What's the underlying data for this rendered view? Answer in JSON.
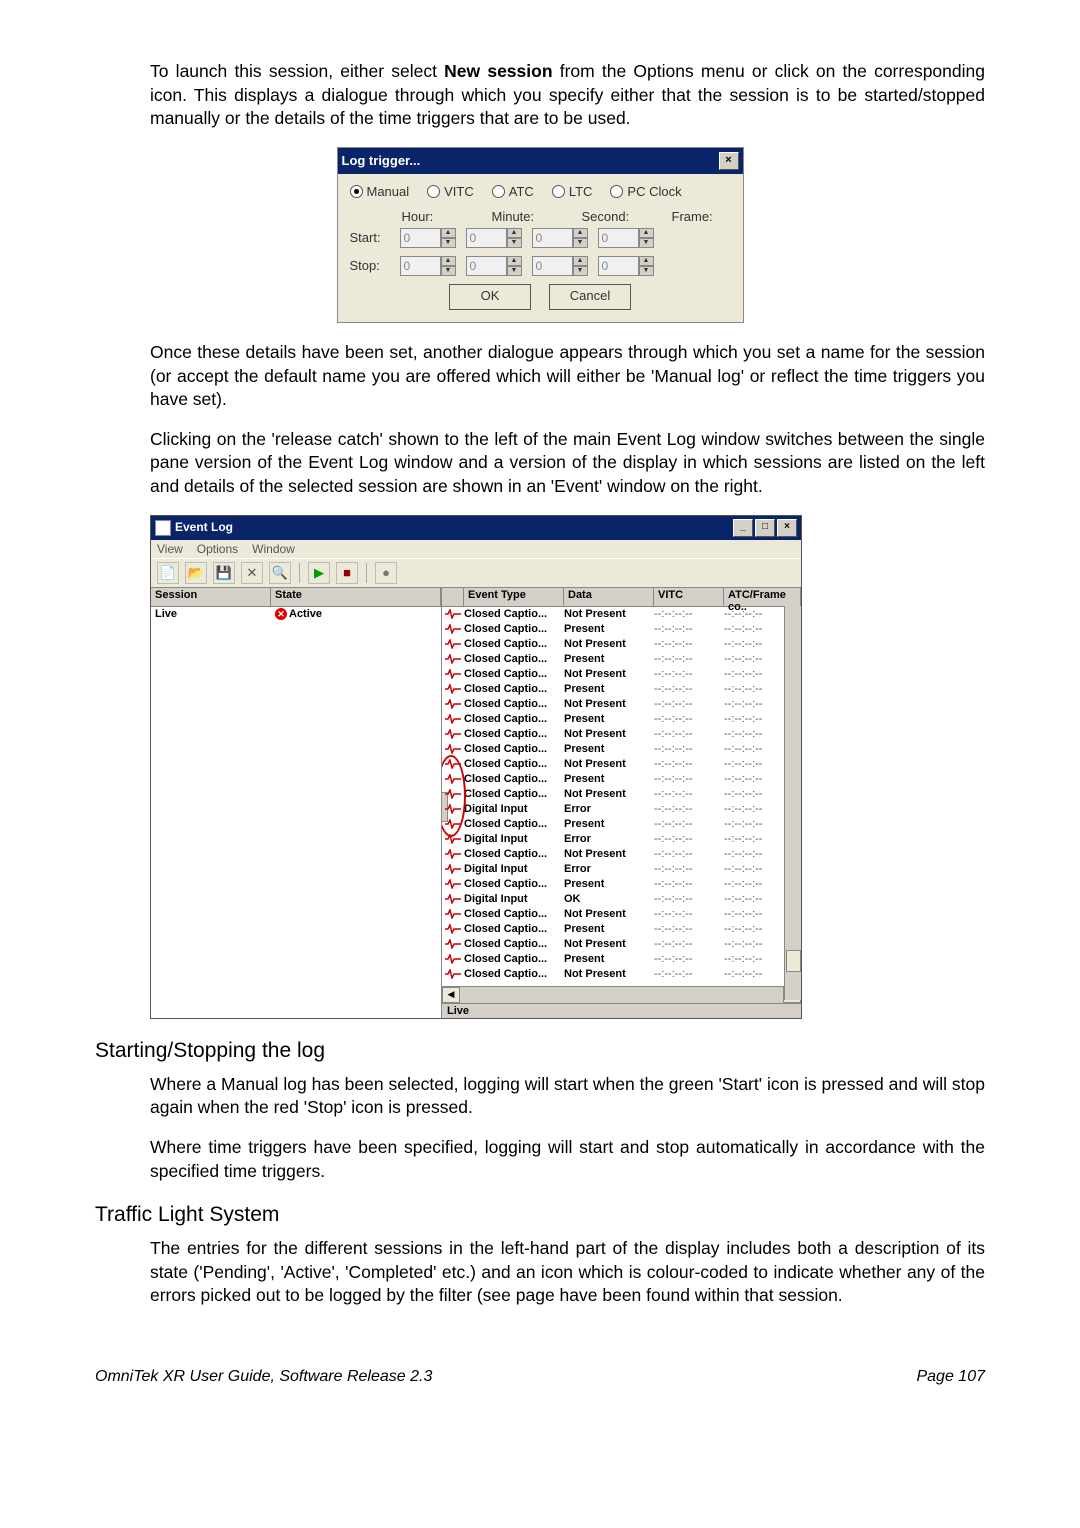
{
  "paragraphs": {
    "p1a": "To launch this session, either select ",
    "p1bold": "New session",
    "p1b": " from the Options menu or click on the corresponding icon. This displays a dialogue through which you specify either that the session is to be started/stopped manually or the details of the time triggers that are to be used.",
    "p2": "Once these details have been set, another dialogue appears through which you set a name for the session (or accept the default name you are offered which will either be 'Manual log' or reflect the time triggers you have set).",
    "p3": "Clicking on the 'release catch' shown to the left of the main Event Log window switches between the single pane version of the Event Log window and a version of the display in which sessions are listed on the left and details of the selected session are shown in an 'Event' window on the right.",
    "p4": "Where a Manual log has been selected, logging will start when the green 'Start' icon is pressed and will stop again when the red 'Stop' icon is pressed.",
    "p5": "Where time triggers have been specified, logging will start and stop automatically in accordance with the specified time triggers.",
    "p6": "The entries for the different sessions in the left-hand part of the display includes both a description of its state ('Pending', 'Active', 'Completed' etc.) and an icon which is colour-coded to indicate whether any of the errors picked out to be logged by the filter (see page have been found within that session."
  },
  "headings": {
    "h_start": "Starting/Stopping the log",
    "h_traffic": "Traffic Light System"
  },
  "dialog": {
    "title": "Log trigger...",
    "close": "×",
    "radios": [
      "Manual",
      "VITC",
      "ATC",
      "LTC",
      "PC Clock"
    ],
    "time_headers": [
      "Hour:",
      "Minute:",
      "Second:",
      "Frame:"
    ],
    "rows": [
      "Start:",
      "Stop:"
    ],
    "spin_value": "0",
    "ok": "OK",
    "cancel": "Cancel"
  },
  "eventlog": {
    "title": "Event Log",
    "menu": [
      "View",
      "Options",
      "Window"
    ],
    "left_headers": [
      "Session",
      "State"
    ],
    "left_row": {
      "session": "Live",
      "state": "Active"
    },
    "right_headers": [
      "Event Type",
      "Data",
      "VITC",
      "ATC/Frame co.."
    ],
    "rows": [
      {
        "et": "Closed Captio...",
        "data": "Not Present"
      },
      {
        "et": "Closed Captio...",
        "data": "Present"
      },
      {
        "et": "Closed Captio...",
        "data": "Not Present"
      },
      {
        "et": "Closed Captio...",
        "data": "Present"
      },
      {
        "et": "Closed Captio...",
        "data": "Not Present"
      },
      {
        "et": "Closed Captio...",
        "data": "Present"
      },
      {
        "et": "Closed Captio...",
        "data": "Not Present"
      },
      {
        "et": "Closed Captio...",
        "data": "Present"
      },
      {
        "et": "Closed Captio...",
        "data": "Not Present"
      },
      {
        "et": "Closed Captio...",
        "data": "Present"
      },
      {
        "et": "Closed Captio...",
        "data": "Not Present"
      },
      {
        "et": "Closed Captio...",
        "data": "Present"
      },
      {
        "et": "Closed Captio...",
        "data": "Not Present"
      },
      {
        "et": "Digital Input",
        "data": "Error"
      },
      {
        "et": "Closed Captio...",
        "data": "Present"
      },
      {
        "et": "Digital Input",
        "data": "Error"
      },
      {
        "et": "Closed Captio...",
        "data": "Not Present"
      },
      {
        "et": "Digital Input",
        "data": "Error"
      },
      {
        "et": "Closed Captio...",
        "data": "Present"
      },
      {
        "et": "Digital Input",
        "data": "OK"
      },
      {
        "et": "Closed Captio...",
        "data": "Not Present"
      },
      {
        "et": "Closed Captio...",
        "data": "Present"
      },
      {
        "et": "Closed Captio...",
        "data": "Not Present"
      },
      {
        "et": "Closed Captio...",
        "data": "Present"
      },
      {
        "et": "Closed Captio...",
        "data": "Not Present"
      }
    ],
    "tc_placeholder": "--:--:--:--",
    "status": "Live"
  },
  "footer": {
    "left": "OmniTek XR User Guide, Software Release 2.3",
    "right": "Page 107"
  }
}
